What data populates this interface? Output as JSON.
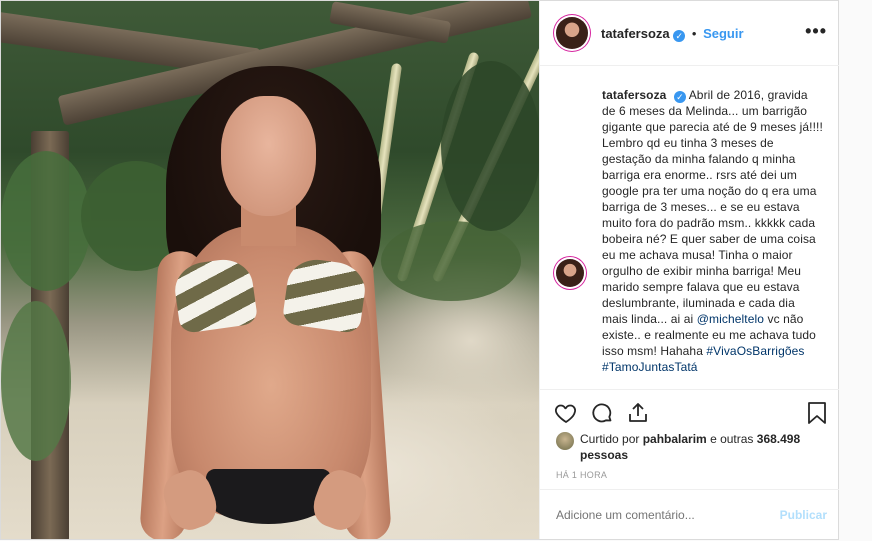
{
  "post": {
    "username": "tatafersoza",
    "follow_label": "Seguir",
    "more_label": "•••",
    "separator": "•",
    "verified_glyph": "✓",
    "caption_parts": [
      "Abril de 2016, gravida de 6 meses da Melinda... um barrigão gigante que parecia até de 9 meses já!!!! Lembro qd eu tinha 3 meses de gestação da minha falando q minha barriga era enorme.. rsrs até dei um google pra ter uma noção do q era uma barriga de 3 meses... e se eu estava muito fora do padrão msm.. kkkkk cada bobeira né? E quer saber de uma coisa eu me achava musa! Tinha o maior orgulho de exibir minha barriga! Meu marido sempre falava que eu estava deslumbrante, iluminada e cada dia mais linda... ai ai ",
      "@micheltelo",
      " vc não existe.. e realmente eu me achava tudo isso msm! Hahaha ",
      "#VivaOsBarrigões",
      " ",
      "#TamoJuntasTatá"
    ],
    "likes": {
      "prefix": "Curtido por ",
      "user": "pahbalarim",
      "middle": " e outras ",
      "count": "368.498",
      "suffix": " pessoas"
    },
    "time": "HÁ 1 HORA",
    "comment_placeholder": "Adicione um comentário...",
    "publish_label": "Publicar"
  },
  "icons": {
    "like": "heart-icon",
    "comment": "comment-icon",
    "share": "share-icon",
    "save": "bookmark-icon",
    "more": "more-icon"
  },
  "colors": {
    "link": "#3897f0",
    "verified": "#3897f0",
    "publish_disabled": "#b2dffc"
  }
}
